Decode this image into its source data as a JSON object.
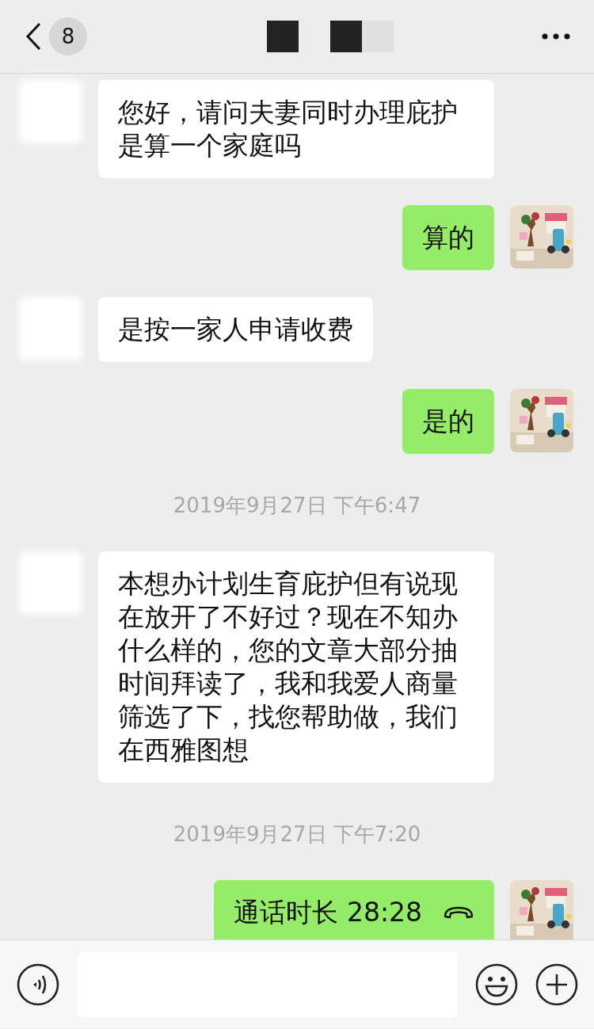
{
  "header": {
    "back_badge": "8"
  },
  "messages": [
    {
      "kind": "received",
      "text": "您好，请问夫妻同时办理庇护是算一个家庭吗"
    },
    {
      "kind": "sent",
      "text": "算的"
    },
    {
      "kind": "received",
      "text": "是按一家人申请收费"
    },
    {
      "kind": "sent",
      "text": "是的"
    },
    {
      "kind": "time",
      "text": "2019年9月27日 下午6:47"
    },
    {
      "kind": "received",
      "text": "本想办计划生育庇护但有说现在放开了不好过？现在不知办什么样的，您的文章大部分抽时间拜读了，我和我爱人商量筛选了下，找您帮助做，我们在西雅图想"
    },
    {
      "kind": "time",
      "text": "2019年9月27日 下午7:20"
    },
    {
      "kind": "call",
      "text": "通话时长 28:28"
    }
  ]
}
